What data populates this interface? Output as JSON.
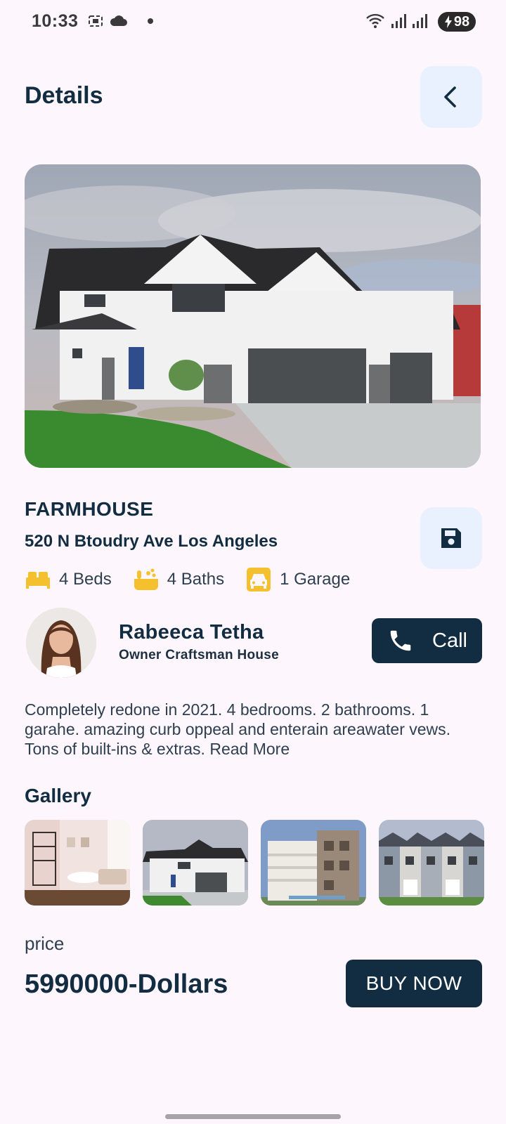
{
  "status_bar": {
    "time": "10:33",
    "battery": "98",
    "icons": [
      "screenshot-icon",
      "cloud-icon",
      "dot-icon",
      "wifi-icon",
      "signal-icon",
      "signal-icon",
      "battery-charging-icon"
    ]
  },
  "header": {
    "title": "Details",
    "back_icon": "chevron-left-icon"
  },
  "property": {
    "name": "FARMHOUSE",
    "address": "520 N Btoudry Ave Los Angeles",
    "save_icon": "save-icon",
    "features": [
      {
        "icon": "bed-icon",
        "label": "4 Beds"
      },
      {
        "icon": "bath-icon",
        "label": "4 Baths"
      },
      {
        "icon": "car-icon",
        "label": "1 Garage"
      }
    ]
  },
  "owner": {
    "name": "Rabeeca Tetha",
    "role": "Owner Craftsman House",
    "call_label": "Call",
    "call_icon": "phone-icon"
  },
  "description": "Completely redone in 2021. 4 bedrooms. 2 bathrooms. 1 garahe. amazing curb oppeal and enterain areawater vews. Tons of built-ins & extras. Read More",
  "gallery": {
    "title": "Gallery"
  },
  "price": {
    "label": "price",
    "value": "5990000-Dollars",
    "buy_label": "BUY NOW"
  },
  "colors": {
    "primary": "#122d42",
    "accent": "#f5c02e",
    "background": "#fdf6fc",
    "button_light": "#e8f1fd"
  }
}
